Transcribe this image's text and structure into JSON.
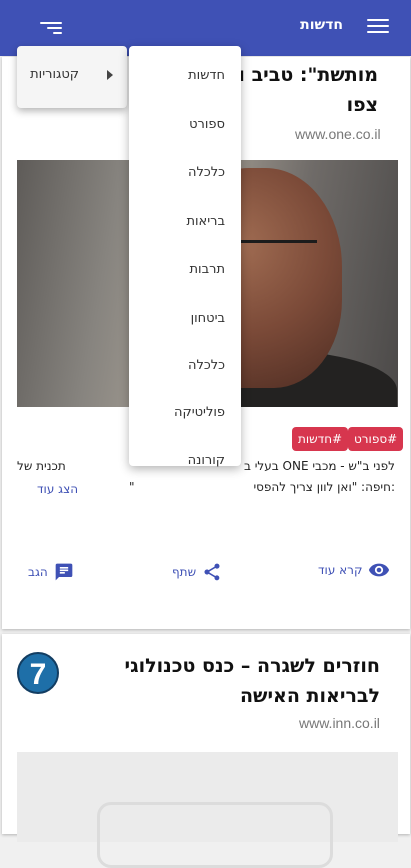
{
  "appbar": {
    "title": "חדשות"
  },
  "card1": {
    "headline_l1": "מותשת\": טביב ונמ",
    "headline_l2": "צפו",
    "domain": "www.one.co.il",
    "tags": [
      "#ספורט",
      "#חדשות"
    ],
    "text_l1": "לפני ב\"ש - מכבי ONE בעלי ב",
    "text_l1_end": "תכנית של",
    "text_l2": ":חיפה: \"ואן לוון צריך להפסי",
    "text_l2_end": "\"",
    "show_more": "הצג עוד",
    "actions": {
      "read_more": "קרא עוד",
      "share": "שתף",
      "report": "הגב"
    }
  },
  "card2": {
    "headline": "חוזרים לשגרה – כנס טכנולוגי לבריאות האישה",
    "domain": "www.inn.co.il",
    "logo_text": "7"
  },
  "menu": {
    "items": [
      "חדשות",
      "ספורט",
      "כלכלה",
      "בריאות",
      "תרבות",
      "ביטחון",
      "כלכלה",
      "פוליטיקה",
      "קורונה"
    ]
  },
  "submenu": {
    "label": "קטגוריות"
  },
  "colors": {
    "primary": "#3f51b5",
    "tag": "#d7364e"
  },
  "icons": [
    "menu-icon",
    "sort-icon",
    "eye-icon",
    "share-icon",
    "comment-icon",
    "submenu-arrow-icon"
  ]
}
